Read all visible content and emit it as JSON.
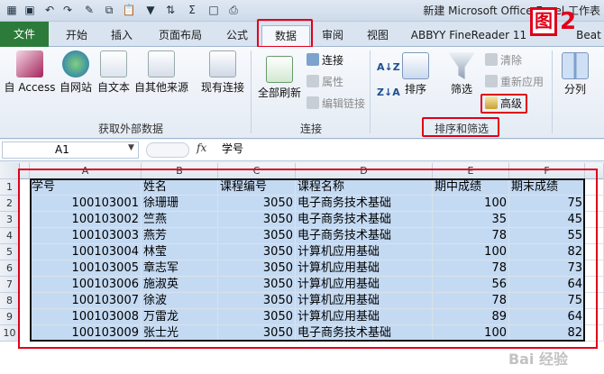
{
  "window": {
    "title": "新建 Microsoft Office Excel 工作表"
  },
  "annotation": {
    "figure_badge": "图",
    "figure_number": "2"
  },
  "quick_access": [
    {
      "icon": "save-icon"
    },
    {
      "icon": "undo-icon"
    },
    {
      "icon": "redo-icon"
    },
    {
      "icon": "format-painter-icon"
    },
    {
      "icon": "copy-icon"
    },
    {
      "icon": "paste-icon"
    },
    {
      "icon": "filter-icon"
    },
    {
      "icon": "sort-icon"
    },
    {
      "icon": "sum-icon"
    },
    {
      "icon": "new-document-icon"
    },
    {
      "icon": "print-preview-icon"
    }
  ],
  "tabs": [
    "文件",
    "开始",
    "插入",
    "页面布局",
    "公式",
    "数据",
    "审阅",
    "视图",
    "ABBYY FineReader 11",
    "Beat"
  ],
  "ribbon": {
    "get_external": {
      "label": "获取外部数据",
      "buttons": [
        "自 Access",
        "自网站",
        "自文本",
        "自其他来源",
        "现有连接"
      ]
    },
    "connections": {
      "label": "连接",
      "refresh": "全部刷新",
      "small": [
        "连接",
        "属性",
        "编辑链接"
      ]
    },
    "sort_filter": {
      "label": "排序和筛选",
      "sort": "排序",
      "filter": "筛选",
      "small": [
        "清除",
        "重新应用",
        "高级"
      ]
    },
    "data_tools": {
      "split": "分列"
    }
  },
  "formula_bar": {
    "name_box": "A1",
    "fx": "fx",
    "content": "学号"
  },
  "columns": [
    "A",
    "B",
    "C",
    "D",
    "E",
    "F"
  ],
  "rows": [
    "1",
    "2",
    "3",
    "4",
    "5",
    "6",
    "7",
    "8",
    "9",
    "10"
  ],
  "table": {
    "headers": [
      "学号",
      "姓名",
      "课程编号",
      "课程名称",
      "期中成绩",
      "期末成绩"
    ],
    "data": [
      [
        "100103001",
        "徐珊珊",
        "3050",
        "电子商务技术基础",
        "100",
        "75"
      ],
      [
        "100103002",
        "竺燕",
        "3050",
        "电子商务技术基础",
        "35",
        "45"
      ],
      [
        "100103003",
        "燕芳",
        "3050",
        "电子商务技术基础",
        "78",
        "55"
      ],
      [
        "100103004",
        "林莹",
        "3050",
        "计算机应用基础",
        "100",
        "82"
      ],
      [
        "100103005",
        "章志军",
        "3050",
        "计算机应用基础",
        "78",
        "73"
      ],
      [
        "100103006",
        "施淑英",
        "3050",
        "计算机应用基础",
        "56",
        "64"
      ],
      [
        "100103007",
        "徐波",
        "3050",
        "计算机应用基础",
        "78",
        "75"
      ],
      [
        "100103008",
        "万雷龙",
        "3050",
        "计算机应用基础",
        "89",
        "64"
      ],
      [
        "100103009",
        "张士光",
        "3050",
        "电子商务技术基础",
        "100",
        "82"
      ]
    ]
  },
  "watermark": "Bai 经验",
  "colors": {
    "file_tab": "#2c7b3a",
    "highlight": "#e0001a",
    "selection": "#c4daf3"
  }
}
